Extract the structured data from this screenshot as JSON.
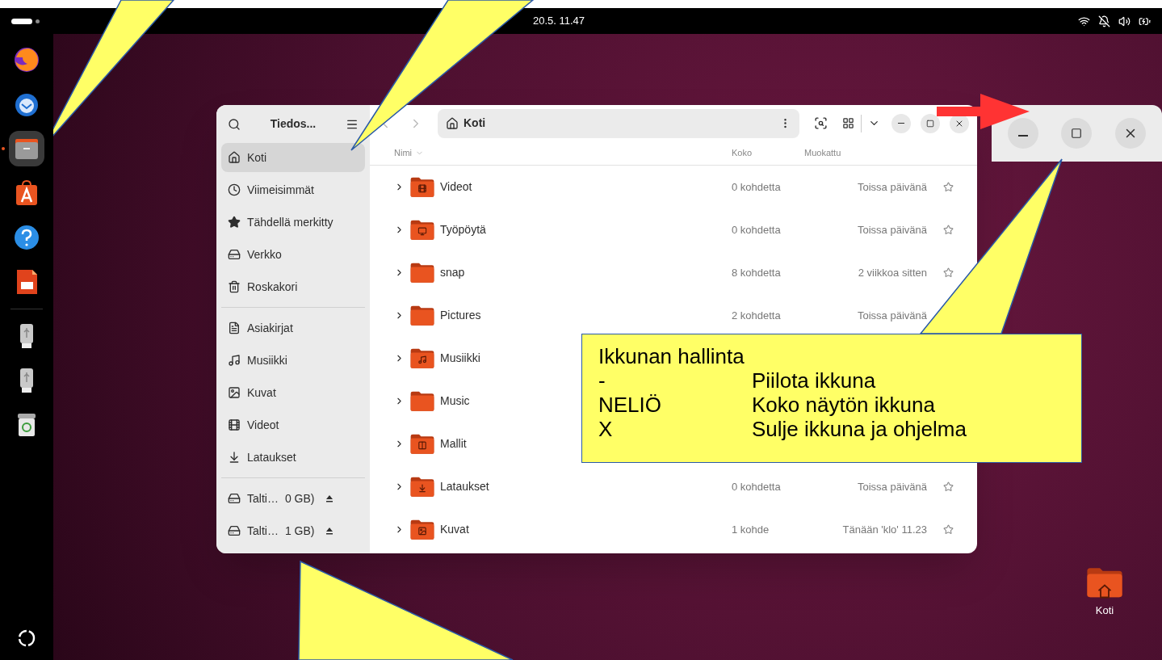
{
  "top_bar": {
    "clock": "20.5. 11.47"
  },
  "dock": {
    "items": [
      {
        "kind": "browser",
        "selected": false
      },
      {
        "kind": "mail",
        "selected": false
      },
      {
        "kind": "files",
        "selected": true
      },
      {
        "kind": "store",
        "selected": false
      },
      {
        "kind": "help",
        "selected": false
      },
      {
        "kind": "slides",
        "selected": false
      },
      {
        "kind": "usb",
        "selected": false
      },
      {
        "kind": "usb",
        "selected": false
      },
      {
        "kind": "trash",
        "selected": false
      }
    ]
  },
  "window": {
    "title": "Tiedos...",
    "sidebar": {
      "items": [
        {
          "label": "Koti",
          "kind": "home",
          "selected": true
        },
        {
          "label": "Viimeisimmät",
          "kind": "recent",
          "selected": false
        },
        {
          "label": "Tähdellä merkitty",
          "kind": "star",
          "selected": false
        },
        {
          "label": "Verkko",
          "kind": "network",
          "selected": false
        },
        {
          "label": "Roskakori",
          "kind": "trash",
          "selected": false
        }
      ],
      "places": [
        {
          "label": "Asiakirjat",
          "kind": "doc",
          "selected": false
        },
        {
          "label": "Musiikki",
          "kind": "music",
          "selected": false
        },
        {
          "label": "Kuvat",
          "kind": "image",
          "selected": false
        },
        {
          "label": "Videot",
          "kind": "video",
          "selected": false
        },
        {
          "label": "Lataukset",
          "kind": "download",
          "selected": false
        }
      ],
      "drives": [
        {
          "label": "Talti…",
          "size": "0 GB)"
        },
        {
          "label": "Talti…",
          "size": "1 GB)"
        }
      ]
    },
    "path": "Koti",
    "table": {
      "columns": [
        "Nimi",
        "Koko",
        "Muokattu"
      ],
      "rows": [
        {
          "name": "Videot",
          "kind": "video",
          "size": "0 kohdetta",
          "modified": "Toissa päivänä"
        },
        {
          "name": "Työpöytä",
          "kind": "desktop",
          "size": "0 kohdetta",
          "modified": "Toissa päivänä"
        },
        {
          "name": "snap",
          "kind": "plain",
          "size": "8 kohdetta",
          "modified": "2 viikkoa sitten"
        },
        {
          "name": "Pictures",
          "kind": "plain",
          "size": "2 kohdetta",
          "modified": "Toissa päivänä"
        },
        {
          "name": "Musiikki",
          "kind": "music"
        },
        {
          "name": "Music",
          "kind": "plain"
        },
        {
          "name": "Mallit",
          "kind": "template"
        },
        {
          "name": "Lataukset",
          "kind": "download",
          "size": "0 kohdetta",
          "modified": "Toissa päivänä"
        },
        {
          "name": "Kuvat",
          "kind": "image",
          "size": "1 kohde",
          "modified": "Tänään 'klo' 11.23"
        }
      ]
    }
  },
  "desktop_icon": {
    "label": "Koti"
  },
  "callout": {
    "title": "Ikkunan hallinta",
    "lines": [
      {
        "key": "-",
        "text": "Piilota ikkuna"
      },
      {
        "key": "NELIÖ",
        "text": "Koko näytön ikkuna"
      },
      {
        "key": "X",
        "text": "Sulje ikkuna ja ohjelma"
      }
    ]
  }
}
